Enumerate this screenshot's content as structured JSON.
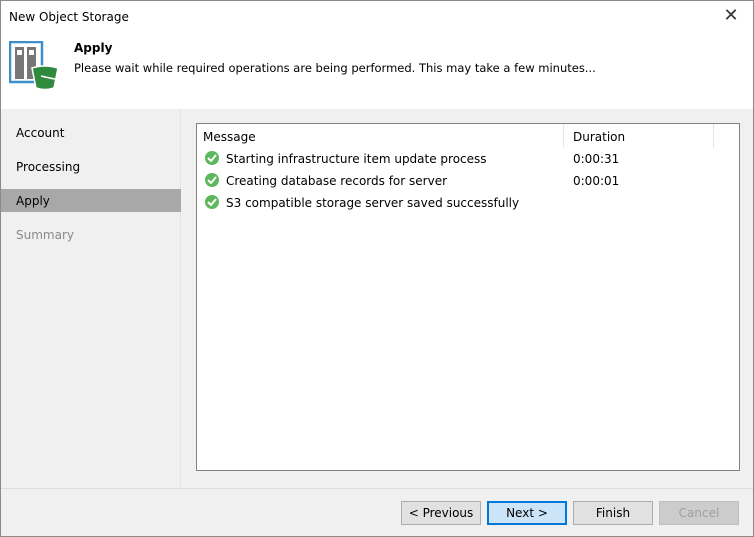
{
  "window": {
    "title": "New Object Storage",
    "close_icon": "close-icon"
  },
  "header": {
    "title": "Apply",
    "subtitle": "Please wait while required operations are being performed. This may take a few minutes...",
    "icon": "object-storage-bucket-icon"
  },
  "nav": {
    "items": [
      {
        "label": "Account",
        "state": "normal"
      },
      {
        "label": "Processing",
        "state": "normal"
      },
      {
        "label": "Apply",
        "state": "selected"
      },
      {
        "label": "Summary",
        "state": "disabled"
      }
    ]
  },
  "log": {
    "columns": [
      "Message",
      "Duration"
    ],
    "rows": [
      {
        "status": "success",
        "message": "Starting infrastructure item update process",
        "duration": "0:00:31"
      },
      {
        "status": "success",
        "message": "Creating database records for server",
        "duration": "0:00:01"
      },
      {
        "status": "success",
        "message": "S3 compatible storage server saved successfully",
        "duration": ""
      }
    ]
  },
  "buttons": {
    "previous": "< Previous",
    "next": "Next >",
    "finish": "Finish",
    "cancel": "Cancel"
  },
  "colors": {
    "success": "#5cb85c",
    "accent": "#0078d7",
    "bucket": "#2f8a3e"
  }
}
